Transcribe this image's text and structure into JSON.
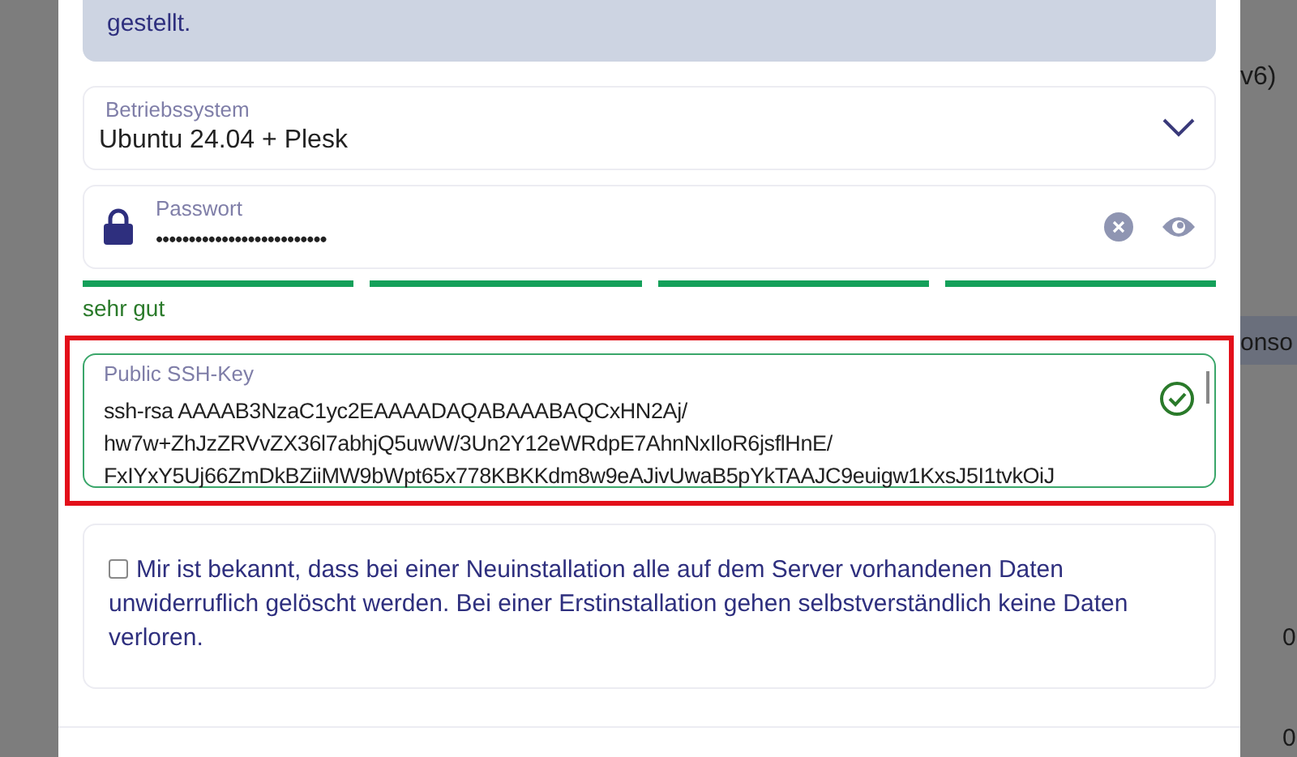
{
  "background": {
    "fragments": [
      "v6)",
      "onso",
      "0",
      "0"
    ]
  },
  "info_box": {
    "text": "gestellt."
  },
  "os_select": {
    "label": "Betriebssystem",
    "value": "Ubuntu 24.04 + Plesk"
  },
  "password": {
    "label": "Passwort",
    "value": "••••••••••••••••••••••••••"
  },
  "strength": {
    "segments": [
      {
        "on": true
      },
      {
        "on": true
      },
      {
        "on": true
      },
      {
        "on": true
      }
    ],
    "label": "sehr gut"
  },
  "ssh_key": {
    "label": "Public SSH-Key",
    "valid": true,
    "highlighted": true,
    "value": "ssh-rsa AAAAB3NzaC1yc2EAAAADAQABAAABAQCxHN2Aj/\nhw7w+ZhJzZRVvZX36l7abhjQ5uwW/3Un2Y12eWRdpE7AhnNxIloR6jsflHnE/\nFxIYxY5Uj66ZmDkBZiiMW9bWpt65x778KBKKdm8w9eAJivUwaB5pYkTAAJC9euigw1KxsJ5I1tvkOiJ"
  },
  "consent": {
    "checked": false,
    "text": "Mir ist bekannt, dass bei einer Neuinstallation alle auf dem Server vorhandenen Daten unwiderruflich gelöscht werden. Bei einer Erstinstallation gehen selbstverständlich keine Daten verloren."
  }
}
